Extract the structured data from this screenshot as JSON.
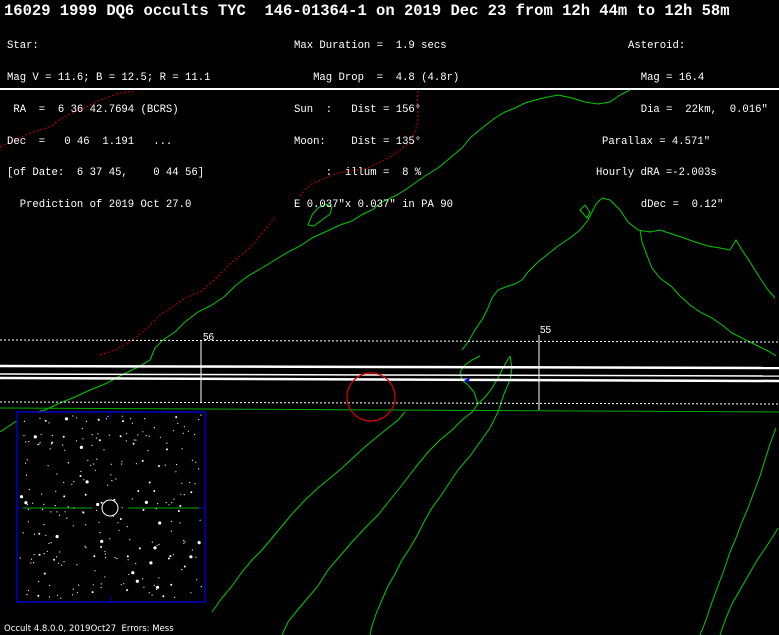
{
  "header": {
    "title": "16029 1999 DQ6 occults TYC  146-01364-1 on 2019 Dec 23 from 12h 44m to 12h 58m",
    "star_block": [
      "Star:",
      "Mag V = 11.6; B = 12.5; R = 11.1",
      " RA  =  6 36 42.7694 (BCRS)",
      "Dec  =   0 46  1.191   ...",
      "[of Date:  6 37 45,    0 44 56]",
      "  Prediction of 2019 Oct 27.0"
    ],
    "event_block": [
      "Max Duration =  1.9 secs",
      "   Mag Drop  =  4.8 (4.8r)",
      "Sun  :   Dist = 156°",
      "Moon:    Dist = 135°",
      "     :  illum =  8 %",
      "E 0.037\"x 0.037\" in PA 90"
    ],
    "asteroid_block": [
      "Asteroid:",
      "  Mag = 16.4",
      "  Dia =  22km,  0.016\"",
      "Parallax = 4.571\"",
      "Hourly dRA =-2.003s",
      "  dDec =  0.12\""
    ]
  },
  "map": {
    "tick_labels": [
      {
        "label": "56",
        "time": "12h 56m"
      },
      {
        "label": "55",
        "time": "12h 55m"
      }
    ],
    "colors": {
      "coastline": "#00cc00",
      "border": "#cc0000",
      "path": "#ffffff",
      "sigma": "#ffffff",
      "asteroid_circle": "#dd0000",
      "finder_frame": "#0000cc"
    }
  },
  "finder_chart": {
    "frame_color": "#0000cc",
    "star_color": "#ffffff"
  },
  "footer": {
    "text": "Occult 4.8.0.0, 2019Oct27  Errors: Mess"
  }
}
